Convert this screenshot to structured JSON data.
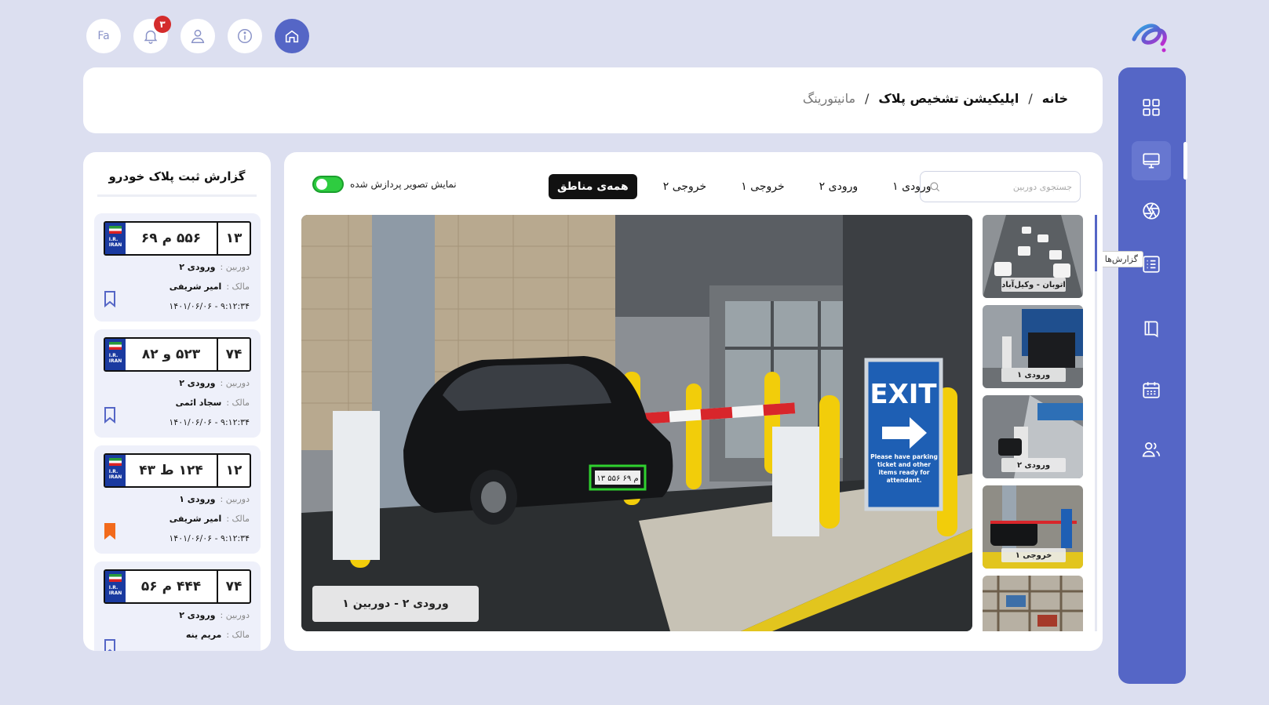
{
  "topbar": {
    "lang": "Fa",
    "notifications": "۳"
  },
  "breadcrumb": {
    "home": "خانه",
    "sep1": "/",
    "app": "اپلیکیشن تشخیص پلاک",
    "sep2": "/",
    "current": "مانیتورینگ"
  },
  "sidebar": {
    "tooltip": "گزارش‌ها"
  },
  "report": {
    "title": "گزارش ثبت پلاک خودرو",
    "camera_label": "دوربین :",
    "owner_label": "مالک :",
    "items": [
      {
        "code": "۱۳",
        "main": "۵۵۶ م ۶۹",
        "camera": "ورودی ۲",
        "owner": "امیر شریفی",
        "time": "۹:۱۲:۳۴ - ۱۴۰۱/۰۶/۰۶",
        "bookmarked": false
      },
      {
        "code": "۷۴",
        "main": "۵۲۳ و ۸۲",
        "camera": "ورودی ۲",
        "owner": "سجاد ائمی",
        "time": "۹:۱۲:۳۴ - ۱۴۰۱/۰۶/۰۶",
        "bookmarked": false
      },
      {
        "code": "۱۲",
        "main": "۱۲۴ ط ۴۳",
        "camera": "ورودی ۱",
        "owner": "امیر شریفی",
        "time": "۹:۱۲:۳۴ - ۱۴۰۱/۰۶/۰۶",
        "bookmarked": true
      },
      {
        "code": "۷۴",
        "main": "۴۴۴ م ۵۶",
        "camera": "ورودی ۲",
        "owner": "مریم ینه",
        "time": "",
        "bookmarked": false
      }
    ]
  },
  "monitor": {
    "search_placeholder": "جستجوی دوربین",
    "tabs": [
      "ورودی ۱",
      "ورودی ۲",
      "خروجی ۱",
      "خروجی ۲",
      "همه‌ی مناطق"
    ],
    "active_tab": "همه‌ی مناطق",
    "toggle_label": "نمایش تصویر پردازش شده",
    "toggle_on": true,
    "feed_caption": "ورودی ۲ - دوربین ۱",
    "feed_plate_text": "۱۳ ۵۵۶ م ۶۹",
    "exit_sign": "EXIT",
    "exit_note": "Please have parking ticket and other items ready for attendant.",
    "thumbs": [
      "اتوبان - وکیل‌آباد",
      "ورودی ۱",
      "ورودی ۲",
      "خروجی ۱",
      ""
    ]
  },
  "colors": {
    "background": "#dcdff0",
    "sidebar": "#5566c6",
    "badge": "#d42c2c",
    "toggle": "#2ecc40",
    "bookmark_active": "#f26a1b",
    "bookmark": "#5566c6"
  }
}
